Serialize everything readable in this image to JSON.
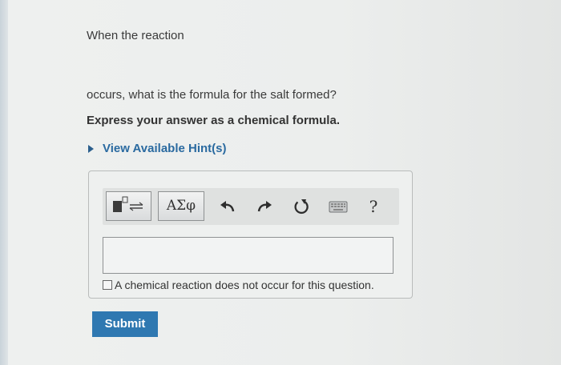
{
  "problem": {
    "intro_text": "When the reaction",
    "question_text": "occurs, what is the formula for the salt formed?",
    "instruction_text": "Express your answer as a chemical formula."
  },
  "hints": {
    "label": "View Available Hint(s)"
  },
  "toolbar": {
    "symbols_label": "ΑΣφ",
    "help_label": "?",
    "icons": [
      "templates-icon",
      "undo-icon",
      "redo-icon",
      "reset-icon",
      "keyboard-icon",
      "help-icon"
    ]
  },
  "answer": {
    "input_value": "",
    "no_reaction_label": "A chemical reaction does not occur for this question.",
    "no_reaction_checked": false
  },
  "submit": {
    "label": "Submit"
  },
  "colors": {
    "link": "#2a6aa0",
    "submit_bg": "#2f78b1",
    "submit_text": "#ffffff"
  }
}
